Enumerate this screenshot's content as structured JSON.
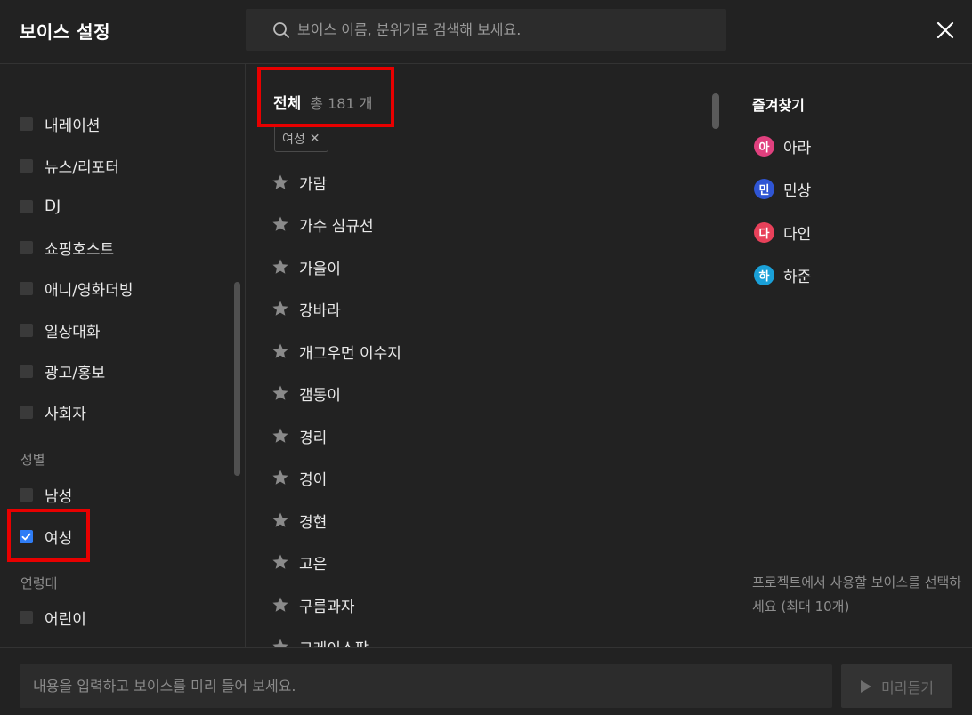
{
  "header": {
    "title": "보이스 설정",
    "search_placeholder": "보이스 이름, 분위기로 검색해 보세요.",
    "close_icon": "close-icon"
  },
  "sidebar": {
    "category_items": [
      {
        "label": "내레이션",
        "checked": false
      },
      {
        "label": "뉴스/리포터",
        "checked": false
      },
      {
        "label": "DJ",
        "checked": false
      },
      {
        "label": "쇼핑호스트",
        "checked": false
      },
      {
        "label": "애니/영화더빙",
        "checked": false
      },
      {
        "label": "일상대화",
        "checked": false
      },
      {
        "label": "광고/홍보",
        "checked": false
      },
      {
        "label": "사회자",
        "checked": false
      }
    ],
    "gender_label": "성별",
    "gender_items": [
      {
        "label": "남성",
        "checked": false
      },
      {
        "label": "여성",
        "checked": true
      }
    ],
    "age_label": "연령대",
    "age_items": [
      {
        "label": "어린이",
        "checked": false
      }
    ]
  },
  "main": {
    "all_title": "전체",
    "all_count": "총 181 개",
    "filter_chip": "여성",
    "voices": [
      "가람",
      "가수 심규선",
      "가을이",
      "강바라",
      "개그우먼 이수지",
      "갬동이",
      "경리",
      "경이",
      "경현",
      "고은",
      "구름과자",
      "그레이스팜"
    ]
  },
  "favorites": {
    "title": "즐겨찾기",
    "items": [
      {
        "initial": "아",
        "label": "아라",
        "color": "#e0407e"
      },
      {
        "initial": "민",
        "label": "민상",
        "color": "#2f55d4"
      },
      {
        "initial": "다",
        "label": "다인",
        "color": "#e8415a"
      },
      {
        "initial": "하",
        "label": "하준",
        "color": "#1aa0d8"
      }
    ],
    "note": "프로젝트에서 사용할 보이스를 선택하세요 (최대 10개)"
  },
  "footer": {
    "preview_placeholder": "내용을 입력하고 보이스를 미리 들어 보세요.",
    "preview_button": "미리듣기"
  },
  "colors": {
    "background": "#222222",
    "accent": "#2f7df6",
    "highlight": "#e80000"
  }
}
